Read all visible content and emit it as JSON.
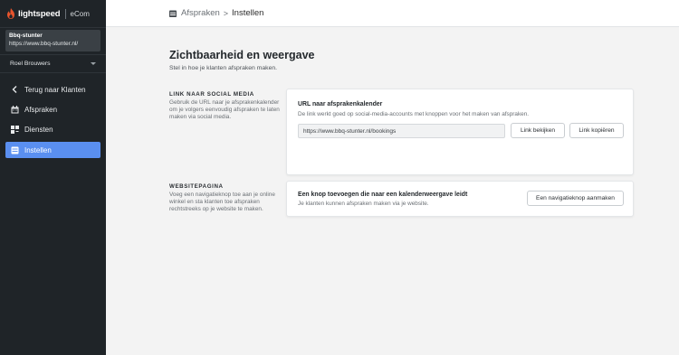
{
  "brand": {
    "name": "lightspeed",
    "product": "eCom",
    "accent": "#e8542c"
  },
  "store": {
    "name": "Bbq-stunter",
    "url": "https://www.bbq-stunter.nl/"
  },
  "user": {
    "name": "Roel Brouwers"
  },
  "nav": [
    {
      "label": "Terug naar Klanten",
      "icon": "chevron-left-icon"
    },
    {
      "label": "Afspraken",
      "icon": "calendar-icon"
    },
    {
      "label": "Diensten",
      "icon": "services-icon"
    },
    {
      "label": "Instellen",
      "icon": "settings-icon",
      "active": true
    }
  ],
  "breadcrumb": {
    "parent": "Afspraken",
    "separator": ">",
    "current": "Instellen"
  },
  "page": {
    "title": "Zichtbaarheid en weergave",
    "subtitle": "Stel in hoe je klanten afspraken maken."
  },
  "social": {
    "heading": "LINK NAAR SOCIAL MEDIA",
    "description": "Gebruik de URL naar je afsprakenkalender om je volgers eenvoudig afspraken te laten maken via social media.",
    "card_title": "URL naar afsprakenkalender",
    "card_text": "De link werkt goed op social-media-accounts met knoppen voor het maken van afspraken.",
    "url_value": "https://www.bbq-stunter.nl/bookings",
    "view_button": "Link bekijken",
    "copy_button": "Link kopiëren"
  },
  "website": {
    "heading": "WEBSITEPAGINA",
    "description": "Voeg een navigatieknop toe aan je online winkel en sta klanten toe afspraken rechtstreeks op je website te maken.",
    "card_title": "Een knop toevoegen die naar een kalenderweergave leidt",
    "card_text": "Je klanten kunnen afspraken maken via je website.",
    "create_button": "Een navigatieknop aanmaken"
  },
  "colors": {
    "sidebar": "#1f2428",
    "active_nav": "#5a8ff0",
    "background": "#f3f3f3"
  }
}
